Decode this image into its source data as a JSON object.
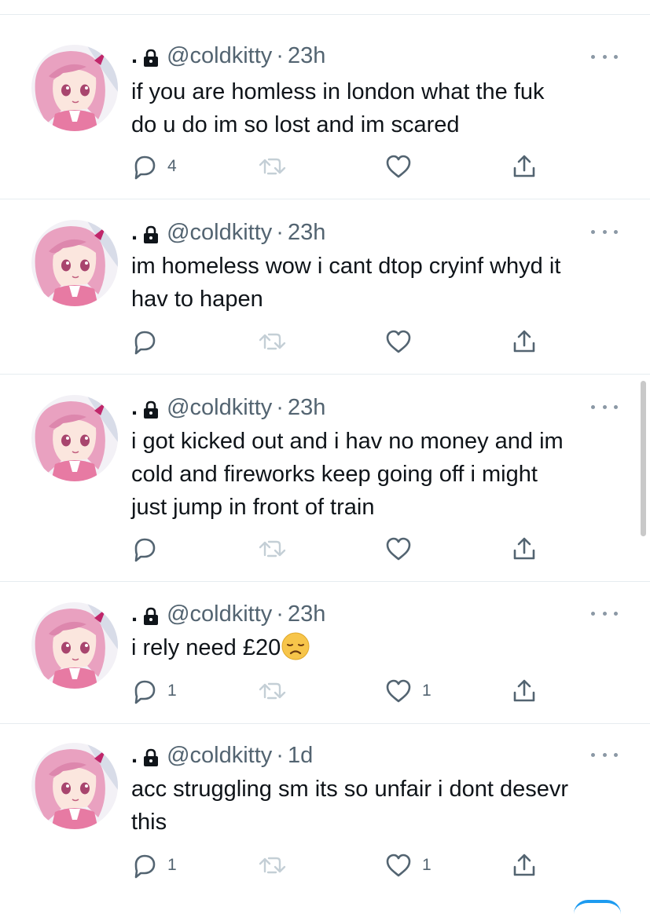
{
  "profile": {
    "display_name": ".",
    "handle": "@coldkitty",
    "separator": "·",
    "protected_icon": "lock-icon"
  },
  "tweets": [
    {
      "time": "23h",
      "text": "if you are homless in london what the fuk\ndo u do im so lost and im scared",
      "emoji": "",
      "replies": "4",
      "likes": ""
    },
    {
      "time": "23h",
      "text": "im homeless wow i cant dtop cryinf whyd it\nhav to hapen",
      "emoji": "",
      "replies": "",
      "likes": ""
    },
    {
      "time": "23h",
      "text": "i got kicked out and i hav no money and im\ncold and fireworks keep going off i might\njust jump in front of train",
      "emoji": "",
      "replies": "",
      "likes": ""
    },
    {
      "time": "23h",
      "text": "i rely need £20",
      "emoji": "disappointed-face-emoji",
      "replies": "1",
      "likes": "1"
    },
    {
      "time": "1d",
      "text": "acc struggling sm its so unfair i dont desevr\nthis",
      "emoji": "",
      "replies": "1",
      "likes": "1"
    }
  ],
  "icons": {
    "reply": "reply-icon",
    "retweet": "retweet-icon",
    "like": "like-icon",
    "share": "share-icon",
    "more": "more-icon"
  },
  "colors": {
    "text": "#0f1419",
    "secondary": "#536471",
    "divider": "#e6ecf0",
    "retweet_disabled": "#c4cfd6",
    "accent": "#1d9bf0"
  }
}
